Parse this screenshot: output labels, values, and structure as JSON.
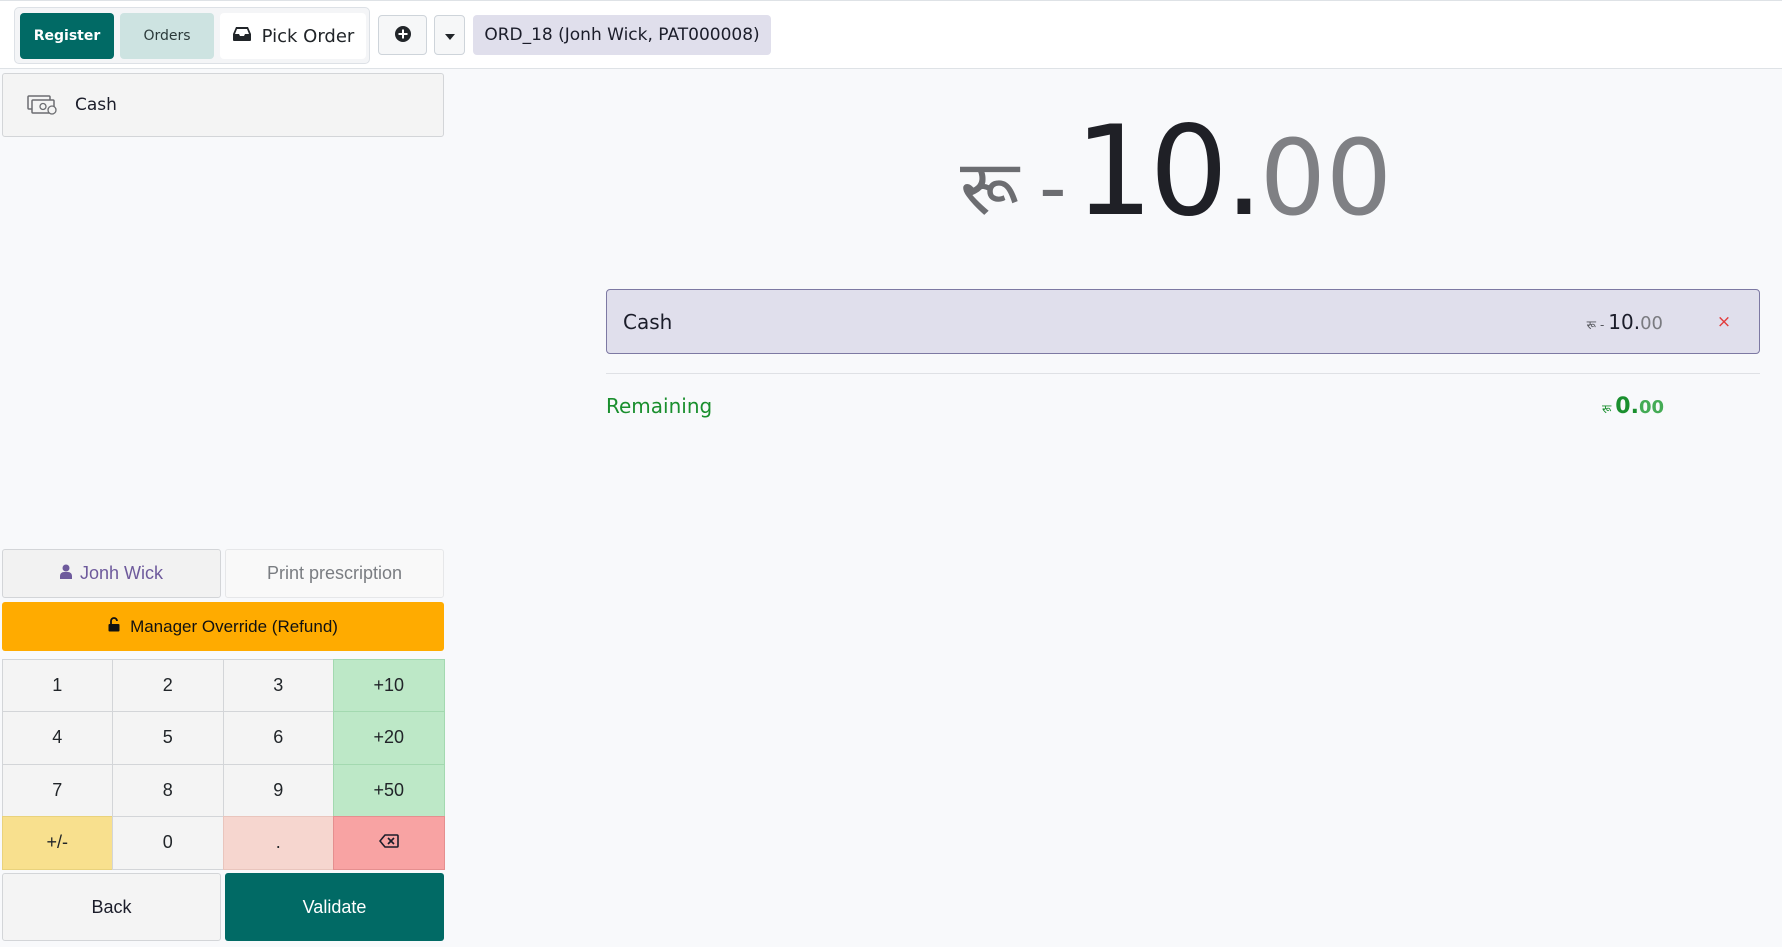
{
  "topbar": {
    "tabs": {
      "register": "Register",
      "orders": "Orders",
      "pick_order": "Pick Order"
    },
    "order_badge": "ORD_18 (Jonh Wick, PAT000008)"
  },
  "payment_methods": [
    {
      "label": "Cash",
      "icon": "cash-icon"
    }
  ],
  "actions": {
    "customer": "Jonh Wick",
    "print_prescription": "Print prescription",
    "manager_override": "Manager Override (Refund)"
  },
  "numpad": {
    "keys": [
      "1",
      "2",
      "3",
      "+10",
      "4",
      "5",
      "6",
      "+20",
      "7",
      "8",
      "9",
      "+50",
      "+/-",
      "0",
      "."
    ]
  },
  "footer": {
    "back": "Back",
    "validate": "Validate"
  },
  "total": {
    "currency": "रू",
    "sign": "-",
    "integer": "10.",
    "decimal": "00"
  },
  "payment_line": {
    "method": "Cash",
    "currency": "रू",
    "sign": "-",
    "integer": "10.",
    "decimal": "00",
    "remove": "×"
  },
  "remaining": {
    "label": "Remaining",
    "currency": "रू",
    "integer": "0.",
    "decimal": "00"
  },
  "colors": {
    "primary": "#016a65",
    "orders_tab": "#cde3e1",
    "badge": "#e0dfec",
    "override": "#ffab00",
    "success": "#1a8f2e",
    "quick_add": "#bde8c7",
    "backspace": "#f8a3a3"
  }
}
